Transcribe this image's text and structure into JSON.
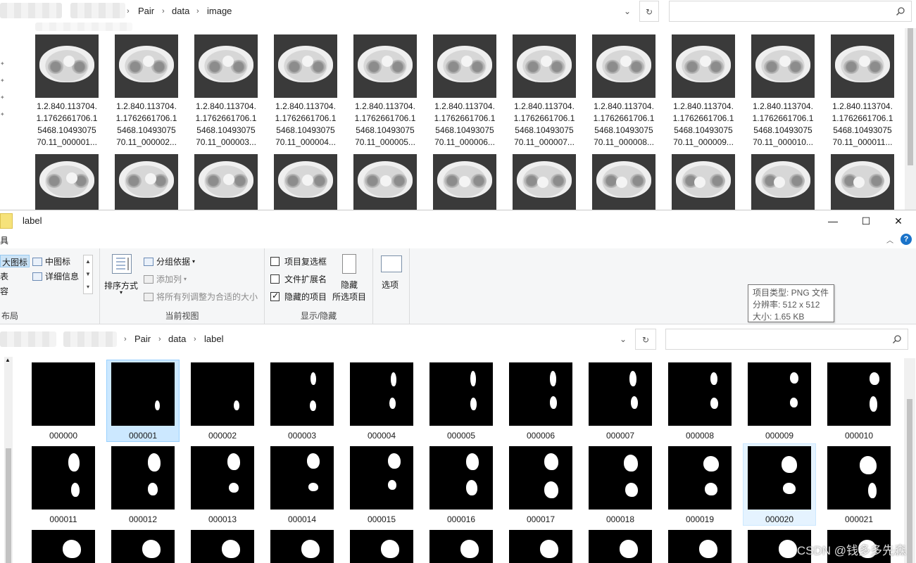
{
  "back_window": {
    "breadcrumb": [
      "Pair",
      "data",
      "image"
    ],
    "thumbnails": [
      {
        "line1": "1.2.840.113704.",
        "line2": "1.1762661706.1",
        "line3": "5468.10493075",
        "line4": "70.11_000001..."
      },
      {
        "line1": "1.2.840.113704.",
        "line2": "1.1762661706.1",
        "line3": "5468.10493075",
        "line4": "70.11_000002..."
      },
      {
        "line1": "1.2.840.113704.",
        "line2": "1.1762661706.1",
        "line3": "5468.10493075",
        "line4": "70.11_000003..."
      },
      {
        "line1": "1.2.840.113704.",
        "line2": "1.1762661706.1",
        "line3": "5468.10493075",
        "line4": "70.11_000004..."
      },
      {
        "line1": "1.2.840.113704.",
        "line2": "1.1762661706.1",
        "line3": "5468.10493075",
        "line4": "70.11_000005..."
      },
      {
        "line1": "1.2.840.113704.",
        "line2": "1.1762661706.1",
        "line3": "5468.10493075",
        "line4": "70.11_000006..."
      },
      {
        "line1": "1.2.840.113704.",
        "line2": "1.1762661706.1",
        "line3": "5468.10493075",
        "line4": "70.11_000007..."
      },
      {
        "line1": "1.2.840.113704.",
        "line2": "1.1762661706.1",
        "line3": "5468.10493075",
        "line4": "70.11_000008..."
      },
      {
        "line1": "1.2.840.113704.",
        "line2": "1.1762661706.1",
        "line3": "5468.10493075",
        "line4": "70.11_000009..."
      },
      {
        "line1": "1.2.840.113704.",
        "line2": "1.1762661706.1",
        "line3": "5468.10493075",
        "line4": "70.11_000010..."
      },
      {
        "line1": "1.2.840.113704.",
        "line2": "1.1762661706.1",
        "line3": "5468.10493075",
        "line4": "70.11_000011..."
      }
    ]
  },
  "front_window": {
    "title": "label",
    "ribbon": {
      "layout": {
        "items": [
          "大图标",
          "中图标",
          "列表",
          "详细信息",
          "内容"
        ],
        "label": "布局",
        "left_fragments": [
          "大图标",
          "列表",
          "内容"
        ],
        "frag_tab": "具"
      },
      "current_view": {
        "sort_label": "排序方式",
        "group_by": "分组依据",
        "add_column": "添加列",
        "fit_columns": "将所有列调整为合适的大小",
        "label": "当前视图"
      },
      "show_hide": {
        "item_checkboxes": "项目复选框",
        "file_extensions": "文件扩展名",
        "hidden_items": "隐藏的项目",
        "hide_selected_line1": "隐藏",
        "hide_selected_line2": "所选项目",
        "label": "显示/隐藏",
        "states": {
          "item_checkboxes": false,
          "file_extensions": false,
          "hidden_items": true
        }
      },
      "options_label": "选项"
    },
    "breadcrumb": [
      "Pair",
      "data",
      "label"
    ],
    "files": [
      "000000",
      "000001",
      "000002",
      "000003",
      "000004",
      "000005",
      "000006",
      "000007",
      "000008",
      "000009",
      "000010",
      "000011",
      "000012",
      "000013",
      "000014",
      "000015",
      "000016",
      "000017",
      "000018",
      "000019",
      "000020",
      "000021"
    ],
    "selected_file": "000001",
    "tooltip": {
      "type_line": "项目类型: PNG 文件",
      "resolution_line": "分辨率: 512 x 512",
      "size_line": "大小: 1.65 KB"
    },
    "window_buttons": {
      "minimize": "—",
      "maximize": "☐",
      "close": "✕"
    },
    "watermark": "CSDN @钱多多先森"
  }
}
